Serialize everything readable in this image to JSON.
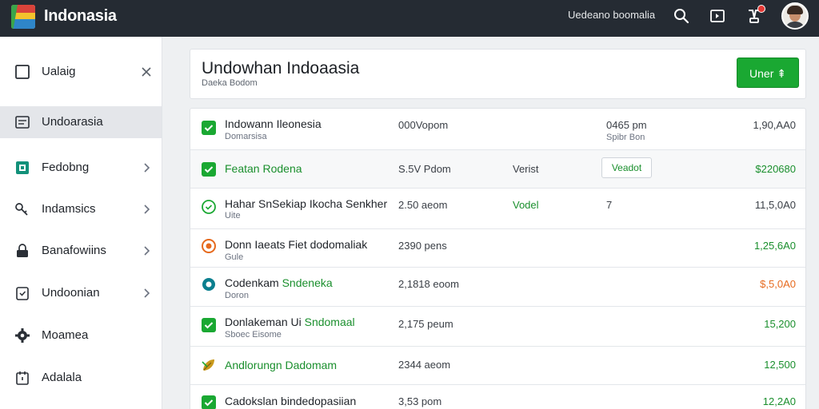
{
  "app": {
    "title": "Indonasia"
  },
  "topbar": {
    "user_label": "Uedeano boomalia",
    "icons": [
      "search-icon",
      "screen-icon",
      "notification-icon"
    ],
    "avatar": "user-avatar"
  },
  "sidebar": {
    "items": [
      {
        "label": "Ualaig",
        "icon": "square-icon",
        "trailing": "close",
        "active": false
      },
      {
        "label": "Undoarasia",
        "icon": "list-icon",
        "trailing": "",
        "active": true
      },
      {
        "label": "Fedobng",
        "icon": "green-box-icon",
        "trailing": "chevron",
        "active": false
      },
      {
        "label": "Indamsics",
        "icon": "key-icon",
        "trailing": "chevron",
        "active": false
      },
      {
        "label": "Banafowiins",
        "icon": "lock-icon",
        "trailing": "chevron",
        "active": false
      },
      {
        "label": "Undoonian",
        "icon": "shield-icon",
        "trailing": "chevron",
        "active": false
      },
      {
        "label": "Moamea",
        "icon": "gear-icon",
        "trailing": "",
        "active": false
      },
      {
        "label": "Adalala",
        "icon": "calendar-icon",
        "trailing": "",
        "active": false
      }
    ]
  },
  "header": {
    "title": "Undowhan Indoaasia",
    "subtitle": "Daeka Bodom",
    "primary_button": "Uner ⇞"
  },
  "rows": [
    {
      "name": "Indowann Ileonesia",
      "sub": "Domarsisa",
      "time": "000Vopom",
      "col3": "",
      "col4": "0465 pm",
      "col4b": "Spibr Bon",
      "amount": "1,90,AA0",
      "icon": "green-check"
    },
    {
      "name": "Featan Rodena",
      "sub": "",
      "time": "S.5V Pdom",
      "col3": "Verist",
      "button": "Veadot",
      "amount": "$220680",
      "icon": "green-check"
    },
    {
      "name": "Hahar SnSekiap Ikocha Senkher",
      "sub": "Uite",
      "time": "2.50 aeom",
      "col3": "Vodel",
      "col4": "7",
      "amount": "11,5,0A0",
      "icon": "green-ring"
    },
    {
      "name": "Donn Iaeats Fiet dodomaliak",
      "sub": "Gule",
      "time": "2390 pens",
      "col3": "",
      "amount": "1,25,6A0",
      "icon": "orange-ring"
    },
    {
      "name": "Codenkam",
      "name_accent": "Sndeneka",
      "sub": "Doron",
      "time": "2,1818 eoom",
      "col3": "",
      "amount": "$,5,0A0",
      "icon": "teal-ring"
    },
    {
      "name": "Donlakeman Ui",
      "name_accent": "Sndomaal",
      "sub": "Sboec Eisome",
      "time": "2,175 peum",
      "col3": "",
      "amount": "15,200",
      "icon": "green-check"
    },
    {
      "name": "Andlorungn Dadomam",
      "sub": "",
      "time": "2344 aeom",
      "col3": "",
      "amount": "12,500",
      "icon": "leaf"
    },
    {
      "name": "Cadokslan bindedopasiian",
      "sub": "",
      "time": "3,53 pom",
      "col3": "",
      "amount": "12,2A0",
      "icon": "green-check"
    }
  ],
  "colors": {
    "topbar": "#252b33",
    "accent_green": "#1aa832",
    "orange": "#e66a1e",
    "teal": "#0b7f8f"
  }
}
